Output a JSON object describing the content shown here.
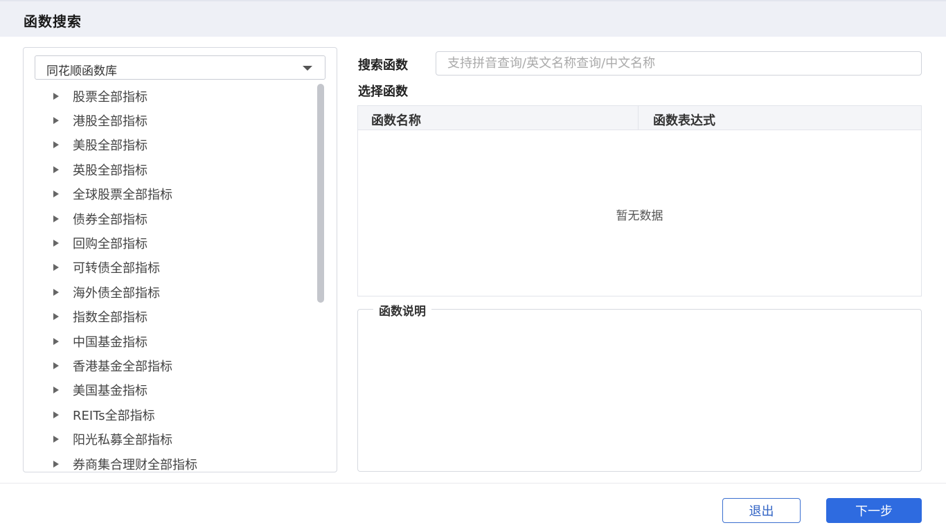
{
  "window": {
    "title": "函数搜索"
  },
  "library_select": {
    "value": "同花顺函数库"
  },
  "tree_items": [
    "股票全部指标",
    "港股全部指标",
    "美股全部指标",
    "英股全部指标",
    "全球股票全部指标",
    "债券全部指标",
    "回购全部指标",
    "可转债全部指标",
    "海外债全部指标",
    "指数全部指标",
    "中国基金指标",
    "香港基金全部指标",
    "美国基金指标",
    "REITs全部指标",
    "阳光私募全部指标",
    "券商集合理财全部指标"
  ],
  "search": {
    "label": "搜索函数",
    "placeholder": "支持拼音查询/英文名称查询/中文名称"
  },
  "select_function": {
    "title": "选择函数",
    "columns": [
      "函数名称",
      "函数表达式"
    ],
    "empty_text": "暂无数据"
  },
  "description": {
    "legend": "函数说明"
  },
  "buttons": {
    "exit": "退出",
    "next": "下一步"
  },
  "colors": {
    "primary": "#2e6be0",
    "header_bg": "#eef0f6"
  }
}
